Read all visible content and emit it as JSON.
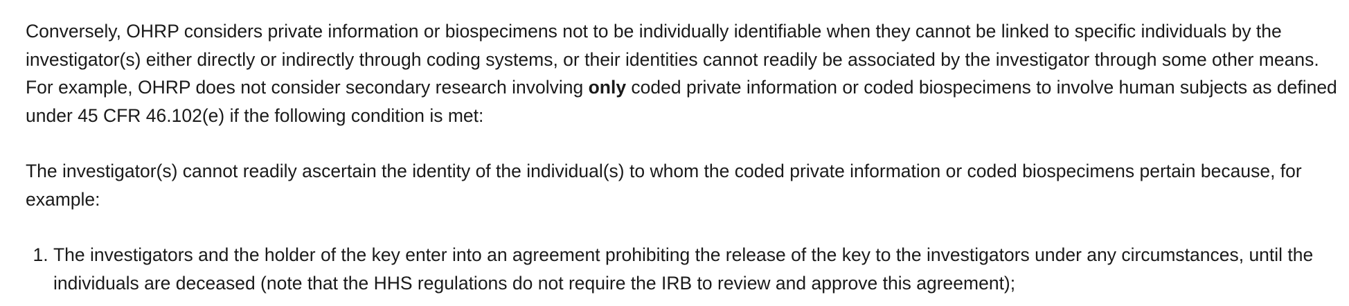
{
  "paragraph_1": {
    "before_bold": "Conversely, OHRP considers private information or biospecimens not to be individually identifiable when they cannot be linked to specific individuals by the investigator(s) either directly or indirectly through coding systems, or their identities cannot readily be associated by the investigator through some other means. For example, OHRP does not consider secondary research involving ",
    "bold": "only",
    "after_bold": " coded private information or coded biospecimens to involve human subjects as defined under 45 CFR 46.102(e) if the following condition is met:"
  },
  "paragraph_2": "The investigator(s) cannot readily ascertain the identity of the individual(s) to whom the coded private information or coded biospecimens pertain because, for example:",
  "list_items": [
    "The investigators and the holder of the key enter into an agreement prohibiting the release of the key to the investigators under any circumstances, until the individuals are deceased (note that the HHS regulations do not require the IRB to review and approve this agreement);"
  ]
}
